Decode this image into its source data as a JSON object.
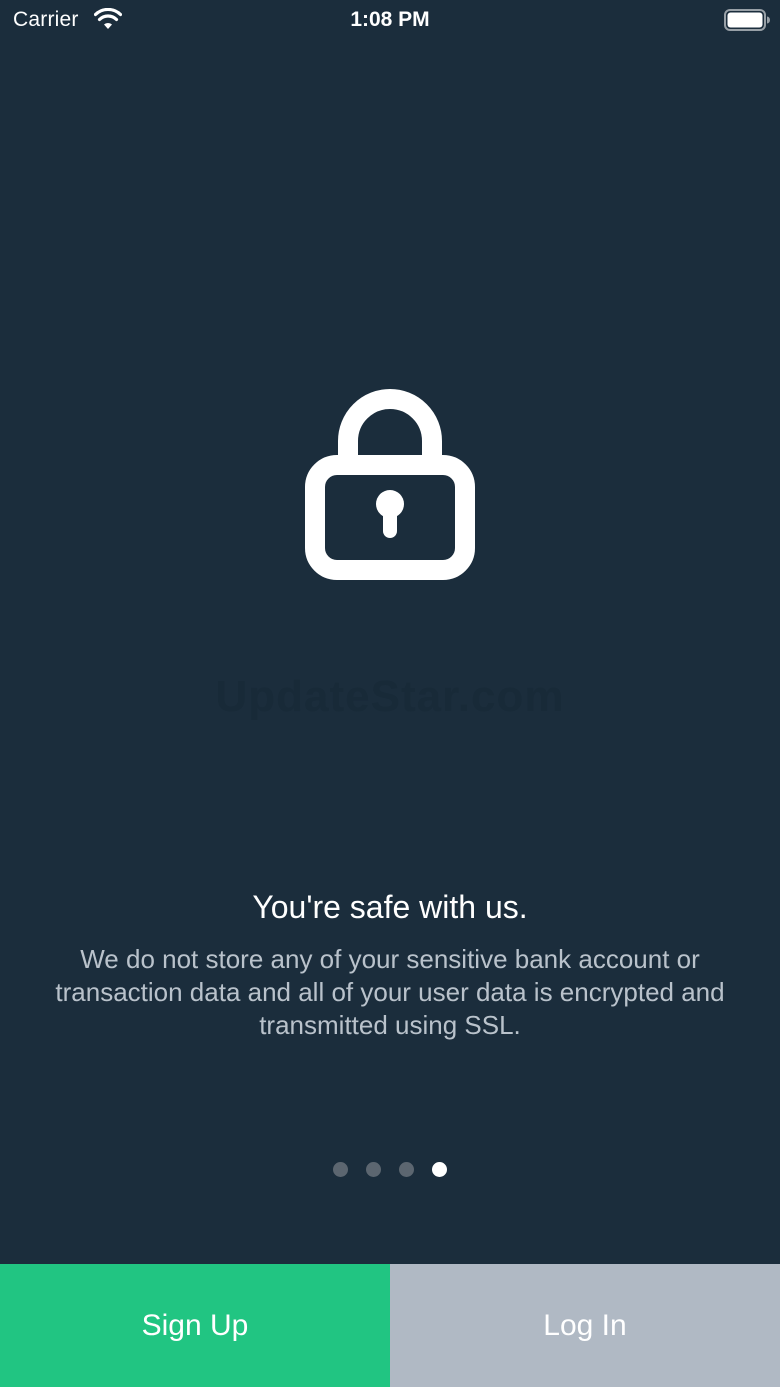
{
  "status_bar": {
    "carrier": "Carrier",
    "time": "1:08 PM"
  },
  "watermark": "UpdateStar.com",
  "onboarding": {
    "headline": "You're safe with us.",
    "description": "We do not store any of your sensitive bank account or transaction data and all of your user data is encrypted and transmitted using SSL.",
    "page_count": 4,
    "current_page": 4
  },
  "actions": {
    "signup_label": "Sign Up",
    "login_label": "Log In"
  },
  "colors": {
    "background": "#1b2d3c",
    "signup": "#21c582",
    "login": "#b0b9c4"
  },
  "icons": {
    "hero": "lock-icon",
    "status_wifi": "wifi-icon",
    "status_battery": "battery-icon"
  }
}
